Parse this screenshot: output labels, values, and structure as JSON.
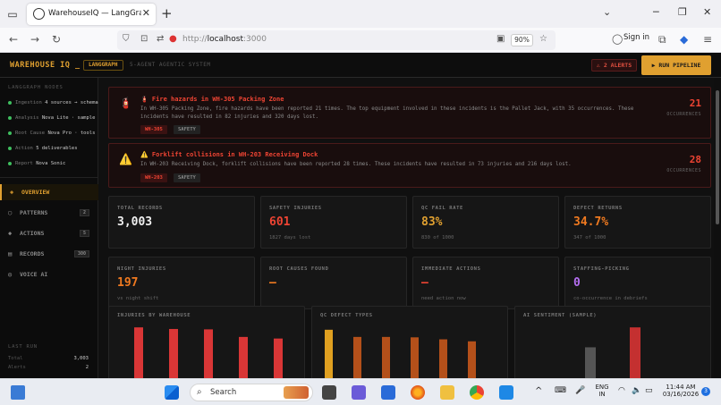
{
  "browser": {
    "tab_title": "WarehouseIQ — LangGraph Ag",
    "url_prefix": "http://",
    "url_host": "localhost",
    "url_port": ":3000",
    "zoom": "90%",
    "sign_in": "Sign in"
  },
  "app": {
    "logo": "WAREHOUSE IQ _",
    "badge": "LANGGRAPH",
    "subtitle": "5-AGENT AGENTIC SYSTEM",
    "alerts_badge": "⚠ 2 ALERTS",
    "run_button": "▶ RUN PIPELINE"
  },
  "sidebar": {
    "nodes_heading": "LANGGRAPH NODES",
    "nodes": [
      {
        "name": "Ingestion",
        "detail": "4 sources → schema"
      },
      {
        "name": "Analysis",
        "detail": "Nova Lite · sample"
      },
      {
        "name": "Root Cause",
        "detail": "Nova Pro · tools"
      },
      {
        "name": "Action",
        "detail": "5 deliverables"
      },
      {
        "name": "Report",
        "detail": "Nova Sonic"
      }
    ],
    "nav": [
      {
        "label": "OVERVIEW",
        "icon": "◈",
        "count": ""
      },
      {
        "label": "PATTERNS",
        "icon": "◯",
        "count": "2"
      },
      {
        "label": "ACTIONS",
        "icon": "◆",
        "count": "5"
      },
      {
        "label": "RECORDS",
        "icon": "▤",
        "count": "300"
      },
      {
        "label": "VOICE AI",
        "icon": "◎",
        "count": ""
      }
    ],
    "last_run_heading": "LAST RUN",
    "last_run": [
      {
        "label": "Total",
        "value": "3,003"
      },
      {
        "label": "Alerts",
        "value": "2"
      }
    ]
  },
  "alerts": [
    {
      "icon": "🧯",
      "title": "🧯 Fire hazards in WH-305 Packing Zone",
      "body": "In WH-305 Packing Zone, fire hazards have been reported 21 times. The top equipment involved in these incidents is the Pallet Jack, with 35 occurrences. These incidents have resulted in 82 injuries and 320 days lost.",
      "tags": [
        "WH-305",
        "SAFETY"
      ],
      "count": "21",
      "count_label": "OCCURRENCES"
    },
    {
      "icon": "⚠️",
      "title": "⚠️ Forklift collisions in WH-203 Receiving Dock",
      "body": "In WH-203 Receiving Dock, forklift collisions have been reported 28 times. These incidents have resulted in 73 injuries and 216 days lost.",
      "tags": [
        "WH-203",
        "SAFETY"
      ],
      "count": "28",
      "count_label": "OCCURRENCES"
    }
  ],
  "stats": [
    {
      "label": "TOTAL RECORDS",
      "value": "3,003",
      "sub": "",
      "color": "#f0f0f0"
    },
    {
      "label": "SAFETY INJURIES",
      "value": "601",
      "sub": "1827 days lost",
      "color": "#ee4433"
    },
    {
      "label": "QC FAIL RATE",
      "value": "83%",
      "sub": "830 of 1000",
      "color": "#e0a030"
    },
    {
      "label": "DEFECT RETURNS",
      "value": "34.7%",
      "sub": "347 of 1000",
      "color": "#f07a20"
    },
    {
      "label": "NIGHT INJURIES",
      "value": "197",
      "sub": "vs night shift",
      "color": "#f07a20"
    },
    {
      "label": "ROOT CAUSES FOUND",
      "value": "—",
      "sub": "",
      "color": "#f07a20"
    },
    {
      "label": "IMMEDIATE ACTIONS",
      "value": "—",
      "sub": "need action now",
      "color": "#ee4433"
    },
    {
      "label": "STAFFING-PICKING",
      "value": "0",
      "sub": "co-occurrence in debriefs",
      "color": "#b46ef0"
    }
  ],
  "charts": [
    {
      "title": "INJURIES BY WAREHOUSE",
      "color": "#d93636"
    },
    {
      "title": "QC DEFECT TYPES",
      "color": "#c85a18"
    },
    {
      "title": "AI SENTIMENT (SAMPLE)",
      "color": "#444"
    }
  ],
  "chart_data": [
    {
      "type": "bar",
      "title": "INJURIES BY WAREHOUSE",
      "series": [
        {
          "values": [
            150,
            146,
            145,
            126,
            122
          ]
        }
      ],
      "colors": [
        "#d93636"
      ]
    },
    {
      "type": "bar",
      "title": "QC DEFECT TYPES",
      "series": [
        {
          "values": [
            144,
            126,
            126,
            125,
            120,
            115
          ]
        }
      ],
      "colors": [
        "#e0a020",
        "#b4501a",
        "#b4501a",
        "#b4501a",
        "#b4501a",
        "#b4501a"
      ]
    },
    {
      "type": "bar",
      "title": "AI SENTIMENT (SAMPLE)",
      "series": [
        {
          "values": [
            100,
            150
          ]
        }
      ],
      "colors": [
        "#555",
        "#c43030"
      ]
    }
  ],
  "taskbar": {
    "search": "Search",
    "lang_top": "ENG",
    "lang_bottom": "IN",
    "time": "11:44 AM",
    "date": "03/16/2026",
    "notif": "3"
  }
}
